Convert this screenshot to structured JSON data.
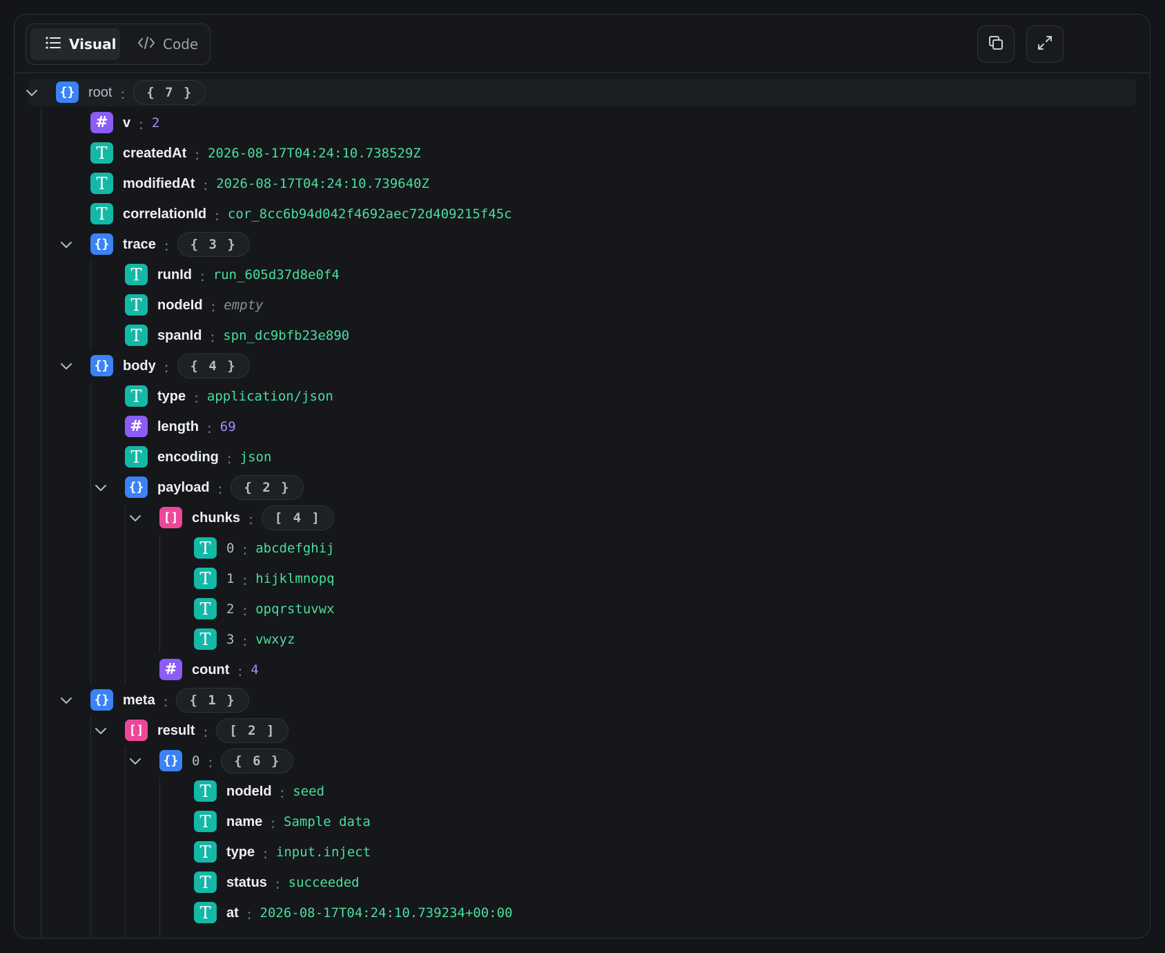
{
  "toolbar": {
    "tabs": [
      {
        "label": "Visual",
        "icon": "list-icon",
        "active": true
      },
      {
        "label": "Code",
        "icon": "code-icon",
        "active": false
      }
    ],
    "actions": [
      {
        "name": "copy-button",
        "icon": "copy-icon"
      },
      {
        "name": "expand-button",
        "icon": "expand-icon"
      }
    ]
  },
  "colors": {
    "object": "#3b82f6",
    "array": "#ec4899",
    "string": "#14b8a6",
    "number": "#8b5cf6",
    "string_value": "#4ade9c",
    "number_value": "#a78bfa"
  },
  "rows": [
    {
      "depth": 0,
      "kind": "object",
      "key": "root",
      "count": "{ 7 }",
      "expanded": true
    },
    {
      "depth": 1,
      "kind": "number",
      "key": "v",
      "value": "2"
    },
    {
      "depth": 1,
      "kind": "string",
      "key": "createdAt",
      "value": "2026-08-17T04:24:10.738529Z"
    },
    {
      "depth": 1,
      "kind": "string",
      "key": "modifiedAt",
      "value": "2026-08-17T04:24:10.739640Z"
    },
    {
      "depth": 1,
      "kind": "string",
      "key": "correlationId",
      "value": "cor_8cc6b94d042f4692aec72d409215f45c"
    },
    {
      "depth": 1,
      "kind": "object",
      "key": "trace",
      "count": "{ 3 }",
      "expanded": true
    },
    {
      "depth": 2,
      "kind": "string",
      "key": "runId",
      "value": "run_605d37d8e0f4"
    },
    {
      "depth": 2,
      "kind": "string",
      "key": "nodeId",
      "value": "empty",
      "empty": true
    },
    {
      "depth": 2,
      "kind": "string",
      "key": "spanId",
      "value": "spn_dc9bfb23e890"
    },
    {
      "depth": 1,
      "kind": "object",
      "key": "body",
      "count": "{ 4 }",
      "expanded": true
    },
    {
      "depth": 2,
      "kind": "string",
      "key": "type",
      "value": "application/json"
    },
    {
      "depth": 2,
      "kind": "number",
      "key": "length",
      "value": "69"
    },
    {
      "depth": 2,
      "kind": "string",
      "key": "encoding",
      "value": "json"
    },
    {
      "depth": 2,
      "kind": "object",
      "key": "payload",
      "count": "{ 2 }",
      "expanded": true
    },
    {
      "depth": 3,
      "kind": "array",
      "key": "chunks",
      "count": "[ 4 ]",
      "expanded": true
    },
    {
      "depth": 4,
      "kind": "string",
      "key": "0",
      "index": true,
      "value": "abcdefghij"
    },
    {
      "depth": 4,
      "kind": "string",
      "key": "1",
      "index": true,
      "value": "hijklmnopq"
    },
    {
      "depth": 4,
      "kind": "string",
      "key": "2",
      "index": true,
      "value": "opqrstuvwx"
    },
    {
      "depth": 4,
      "kind": "string",
      "key": "3",
      "index": true,
      "value": "vwxyz"
    },
    {
      "depth": 3,
      "kind": "number",
      "key": "count",
      "value": "4"
    },
    {
      "depth": 1,
      "kind": "object",
      "key": "meta",
      "count": "{ 1 }",
      "expanded": true
    },
    {
      "depth": 2,
      "kind": "array",
      "key": "result",
      "count": "[ 2 ]",
      "expanded": true
    },
    {
      "depth": 3,
      "kind": "object",
      "key": "0",
      "index": true,
      "count": "{ 6 }",
      "expanded": true
    },
    {
      "depth": 4,
      "kind": "string",
      "key": "nodeId",
      "value": "seed"
    },
    {
      "depth": 4,
      "kind": "string",
      "key": "name",
      "value": "Sample data"
    },
    {
      "depth": 4,
      "kind": "string",
      "key": "type",
      "value": "input.inject"
    },
    {
      "depth": 4,
      "kind": "string",
      "key": "status",
      "value": "succeeded"
    },
    {
      "depth": 4,
      "kind": "string",
      "key": "at",
      "value": "2026-08-17T04:24:10.739234+00:00"
    }
  ]
}
